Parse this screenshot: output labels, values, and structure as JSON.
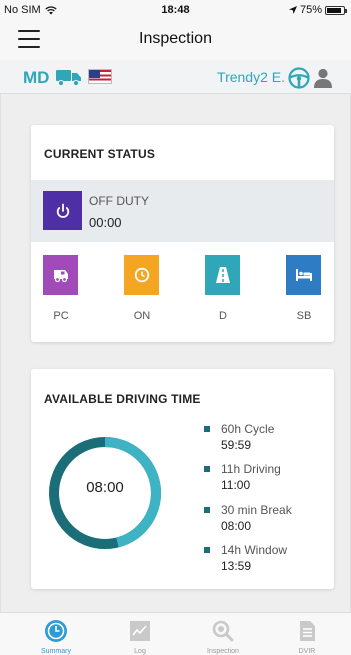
{
  "status_bar": {
    "carrier": "No SIM",
    "time": "18:48",
    "battery": "75%",
    "battery_level": 0.75
  },
  "nav": {
    "title": "Inspection",
    "menu_icon": "hamburger-icon"
  },
  "info_bar": {
    "state": "MD",
    "user": "Trendy2 E.",
    "icons": [
      "truck-icon",
      "us-flag-icon",
      "steering-wheel-icon",
      "person-icon"
    ]
  },
  "current_status": {
    "title": "CURRENT STATUS",
    "duty_label": "OFF DUTY",
    "duty_time": "00:00",
    "buttons": [
      {
        "label": "PC",
        "color": "#a04bb8",
        "icon": "car-icon"
      },
      {
        "label": "ON",
        "color": "#f4a623",
        "icon": "clock-icon"
      },
      {
        "label": "D",
        "color": "#2fa7b8",
        "icon": "road-icon"
      },
      {
        "label": "SB",
        "color": "#2e7cc3",
        "icon": "bed-icon"
      }
    ]
  },
  "available": {
    "title": "AVAILABLE DRIVING TIME",
    "center_value": "08:00",
    "items": [
      {
        "name": "60h Cycle",
        "value": "59:59"
      },
      {
        "name": "11h Driving",
        "value": "11:00"
      },
      {
        "name": "30 min Break",
        "value": "08:00"
      },
      {
        "name": "14h Window",
        "value": "13:59"
      }
    ],
    "ring_fraction": 0.46,
    "ring_colors": {
      "used": "#1b6e78",
      "remaining": "#3db3c4"
    }
  },
  "tabs": [
    {
      "label": "Summary",
      "icon": "clock-icon",
      "active": true
    },
    {
      "label": "Log",
      "icon": "chart-icon",
      "active": false
    },
    {
      "label": "Inspection",
      "icon": "magnifier-icon",
      "active": false
    },
    {
      "label": "DVIR",
      "icon": "document-icon",
      "active": false
    }
  ]
}
